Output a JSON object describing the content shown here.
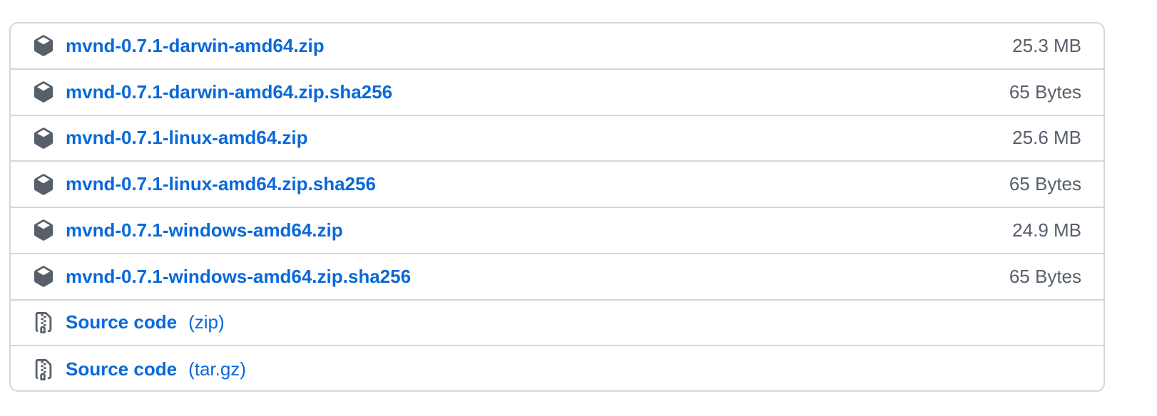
{
  "colors": {
    "link": "#0969da",
    "muted_text": "#57606a",
    "border": "#d0d7de",
    "icon": "#57606a"
  },
  "assets": [
    {
      "name": "mvnd-0.7.1-darwin-amd64.zip",
      "size": "25.3 MB",
      "icon": "package-icon"
    },
    {
      "name": "mvnd-0.7.1-darwin-amd64.zip.sha256",
      "size": "65 Bytes",
      "icon": "package-icon"
    },
    {
      "name": "mvnd-0.7.1-linux-amd64.zip",
      "size": "25.6 MB",
      "icon": "package-icon"
    },
    {
      "name": "mvnd-0.7.1-linux-amd64.zip.sha256",
      "size": "65 Bytes",
      "icon": "package-icon"
    },
    {
      "name": "mvnd-0.7.1-windows-amd64.zip",
      "size": "24.9 MB",
      "icon": "package-icon"
    },
    {
      "name": "mvnd-0.7.1-windows-amd64.zip.sha256",
      "size": "65 Bytes",
      "icon": "package-icon"
    }
  ],
  "source_code": [
    {
      "label": "Source code",
      "format": "(zip)",
      "icon": "file-zip-icon"
    },
    {
      "label": "Source code",
      "format": "(tar.gz)",
      "icon": "file-zip-icon"
    }
  ]
}
